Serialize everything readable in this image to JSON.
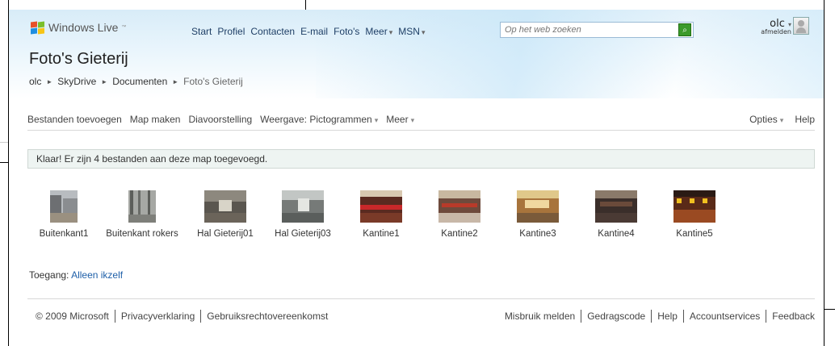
{
  "brand": {
    "name": "Windows Live",
    "trademark": "™"
  },
  "topnav": {
    "items": [
      {
        "label": "Start",
        "dropdown": false
      },
      {
        "label": "Profiel",
        "dropdown": false
      },
      {
        "label": "Contacten",
        "dropdown": false
      },
      {
        "label": "E-mail",
        "dropdown": false
      },
      {
        "label": "Foto's",
        "dropdown": false
      },
      {
        "label": "Meer",
        "dropdown": true
      },
      {
        "label": "MSN",
        "dropdown": true
      }
    ]
  },
  "search": {
    "placeholder": "Op het web zoeken"
  },
  "user": {
    "name": "olc",
    "signout": "afmelden"
  },
  "page_title": "Foto's Gieterij",
  "breadcrumb": [
    "olc",
    "SkyDrive",
    "Documenten",
    "Foto's Gieterij"
  ],
  "toolbar": {
    "add_files": "Bestanden toevoegen",
    "make_folder": "Map maken",
    "slideshow": "Diavoorstelling",
    "view": "Weergave: Pictogrammen",
    "more": "Meer",
    "options": "Opties",
    "help": "Help"
  },
  "notice": "Klaar! Er zijn 4 bestanden aan deze map toegevoegd.",
  "photos": [
    {
      "name": "Buitenkant1",
      "tone": "#8a8d90"
    },
    {
      "name": "Buitenkant rokers",
      "tone": "#7e7f7a"
    },
    {
      "name": "Hal Gieterij01",
      "tone": "#6b645a"
    },
    {
      "name": "Hal Gieterij03",
      "tone": "#767a78"
    },
    {
      "name": "Kantine1",
      "tone": "#7a3a28"
    },
    {
      "name": "Kantine2",
      "tone": "#6e4a3c"
    },
    {
      "name": "Kantine3",
      "tone": "#a8743c"
    },
    {
      "name": "Kantine4",
      "tone": "#4a3a34"
    },
    {
      "name": "Kantine5",
      "tone": "#9a4a22"
    }
  ],
  "access": {
    "label": "Toegang:",
    "value": "Alleen ikzelf"
  },
  "footer": {
    "left": [
      "© 2009 Microsoft",
      "Privacyverklaring",
      "Gebruiksrechtovereenkomst"
    ],
    "right": [
      "Misbruik melden",
      "Gedragscode",
      "Help",
      "Accountservices",
      "Feedback"
    ]
  },
  "colors": {
    "link": "#1e5fa8",
    "nav_text": "#1f3f66",
    "header_top": "#d8ecf8",
    "notice_bg": "#eef4f2"
  }
}
